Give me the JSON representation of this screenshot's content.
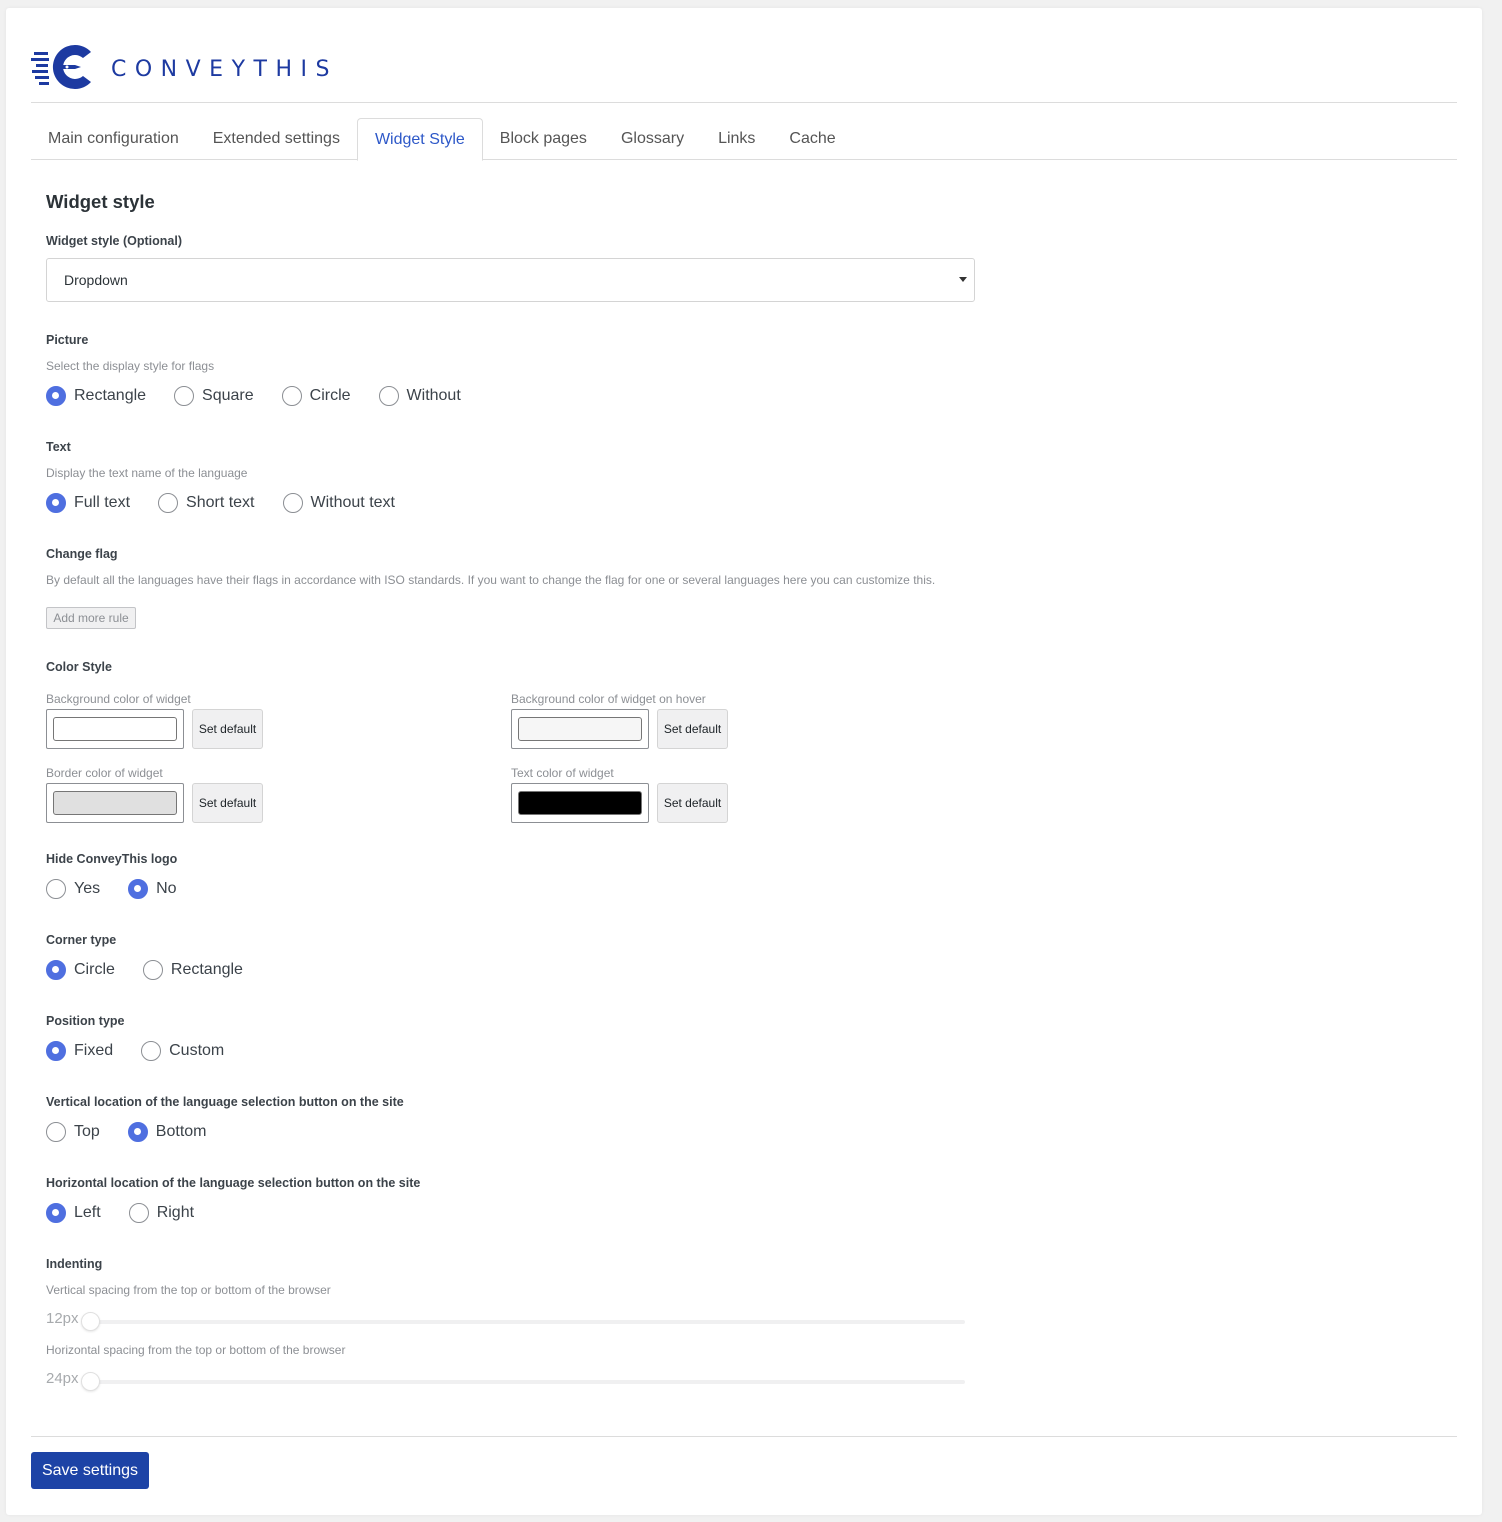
{
  "brand": {
    "name": "CONVEYTHIS",
    "color": "#1d3aa1"
  },
  "tabs": [
    {
      "label": "Main configuration"
    },
    {
      "label": "Extended settings"
    },
    {
      "label": "Widget Style",
      "active": true
    },
    {
      "label": "Block pages"
    },
    {
      "label": "Glossary"
    },
    {
      "label": "Links"
    },
    {
      "label": "Cache"
    }
  ],
  "section_title": "Widget style",
  "widget_style": {
    "label": "Widget style (Optional)",
    "value": "Dropdown"
  },
  "picture": {
    "label": "Picture",
    "desc": "Select the display style for flags",
    "options": [
      "Rectangle",
      "Square",
      "Circle",
      "Without"
    ],
    "selected": "Rectangle"
  },
  "text": {
    "label": "Text",
    "desc": "Display the text name of the language",
    "options": [
      "Full text",
      "Short text",
      "Without text"
    ],
    "selected": "Full text"
  },
  "change_flag": {
    "label": "Change flag",
    "desc": "By default all the languages have their flags in accordance with ISO standards. If you want to change the flag for one or several languages here you can customize this.",
    "button": "Add more rule"
  },
  "color_style": {
    "label": "Color Style",
    "set_default": "Set default",
    "bg": {
      "label": "Background color of widget",
      "color": "#ffffff"
    },
    "bg_hover": {
      "label": "Background color of widget on hover",
      "color": "#f6f6f6"
    },
    "border": {
      "label": "Border color of widget",
      "color": "#e0e0e0"
    },
    "text": {
      "label": "Text color of widget",
      "color": "#000000"
    }
  },
  "hide_logo": {
    "label": "Hide ConveyThis logo",
    "options": [
      "Yes",
      "No"
    ],
    "selected": "No"
  },
  "corner_type": {
    "label": "Corner type",
    "options": [
      "Circle",
      "Rectangle"
    ],
    "selected": "Circle"
  },
  "position_type": {
    "label": "Position type",
    "options": [
      "Fixed",
      "Custom"
    ],
    "selected": "Fixed"
  },
  "vertical_location": {
    "label": "Vertical location of the language selection button on the site",
    "options": [
      "Top",
      "Bottom"
    ],
    "selected": "Bottom"
  },
  "horizontal_location": {
    "label": "Horizontal location of the language selection button on the site",
    "options": [
      "Left",
      "Right"
    ],
    "selected": "Left"
  },
  "indenting": {
    "label": "Indenting",
    "vertical": {
      "desc": "Vertical spacing from the top or bottom of the browser",
      "value": "12px"
    },
    "horizontal": {
      "desc": "Horizontal spacing from the top or bottom of the browser",
      "value": "24px"
    }
  },
  "save_button": "Save settings",
  "accent_color": "#4f6fe0",
  "save_color": "#1d43a6"
}
